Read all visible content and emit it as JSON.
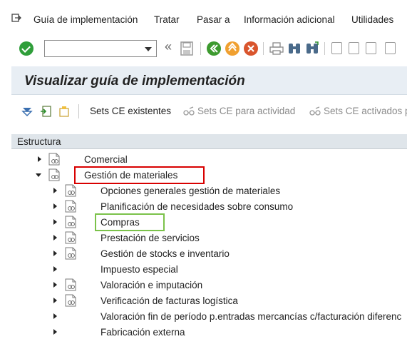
{
  "menubar": {
    "icon": "exit-menu-icon",
    "items": [
      {
        "label": "Guía de implementación"
      },
      {
        "label": "Tratar"
      },
      {
        "label": "Pasar a"
      },
      {
        "label": "Información adicional"
      },
      {
        "label": "Utilidades"
      }
    ]
  },
  "toolbar": {
    "command_field_value": "",
    "back_glyph": "«",
    "icons": [
      "enter-icon",
      "save-icon",
      "back-icon",
      "exit-icon",
      "cancel-icon",
      "print-icon",
      "find-icon",
      "find-next-icon",
      "first-page-icon",
      "previous-page-icon",
      "next-page-icon",
      "last-page-icon"
    ]
  },
  "title": "Visualizar guía de implementación",
  "app_toolbar": {
    "icons": [
      "expand-all-icon",
      "export-icon",
      "folder-icon"
    ],
    "buttons": [
      {
        "label": "Sets CE existentes",
        "enabled": true
      },
      {
        "label": "Sets CE para actividad",
        "enabled": false
      },
      {
        "label": "Sets CE activados p",
        "enabled": false
      }
    ]
  },
  "tree": {
    "header": "Estructura",
    "nodes": [
      {
        "label": "Comercial",
        "expanded": false
      },
      {
        "label": "Gestión de materiales",
        "expanded": true
      },
      {
        "label": "Opciones generales gestión de materiales"
      },
      {
        "label": "Planificación de necesidades sobre consumo"
      },
      {
        "label": "Compras"
      },
      {
        "label": "Prestación de servicios"
      },
      {
        "label": "Gestión de stocks e inventario"
      },
      {
        "label": "Impuesto especial"
      },
      {
        "label": "Valoración e imputación"
      },
      {
        "label": "Verificación de facturas logística"
      },
      {
        "label": "Valoración fin de período p.entradas mercancías c/facturación diferenc"
      },
      {
        "label": "Fabricación externa"
      }
    ]
  },
  "colors": {
    "highlight_red": "#d80000",
    "highlight_green": "#7bc24a",
    "check_green": "#2f9e3a",
    "back_green": "#3d9a2f",
    "exit_orange": "#f0a030",
    "cancel_red": "#d9552d",
    "title_bg": "#e8eef4",
    "header_bg": "#dfe5ea"
  }
}
